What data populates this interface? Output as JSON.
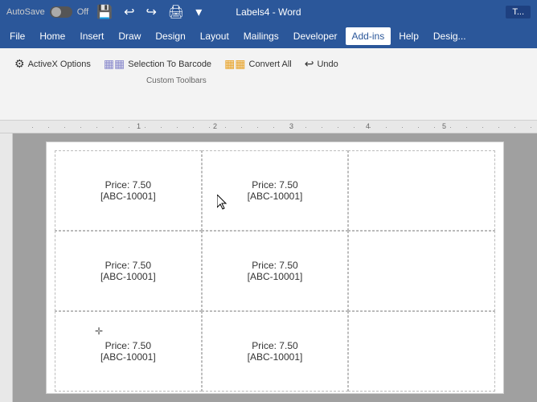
{
  "titlebar": {
    "autosave_label": "AutoSave",
    "autosave_state": "Off",
    "title": "Labels4 - Word",
    "tab_label": "T..."
  },
  "menubar": {
    "items": [
      {
        "label": "File",
        "id": "file"
      },
      {
        "label": "Home",
        "id": "home"
      },
      {
        "label": "Insert",
        "id": "insert"
      },
      {
        "label": "Draw",
        "id": "draw"
      },
      {
        "label": "Design",
        "id": "design"
      },
      {
        "label": "Layout",
        "id": "layout"
      },
      {
        "label": "Mailings",
        "id": "mailings"
      },
      {
        "label": "Developer",
        "id": "developer"
      },
      {
        "label": "Add-ins",
        "id": "addins",
        "active": true
      },
      {
        "label": "Help",
        "id": "help"
      },
      {
        "label": "Desig...",
        "id": "desig2"
      }
    ]
  },
  "ribbon": {
    "buttons": [
      {
        "id": "activex",
        "icon": "⚙",
        "label": "ActiveX Options"
      },
      {
        "id": "selection-barcode",
        "icon": "▦",
        "label": "Selection To Barcode"
      },
      {
        "id": "convert-all",
        "icon": "▦",
        "label": "Convert All"
      },
      {
        "id": "undo",
        "icon": "↩",
        "label": "Undo"
      }
    ],
    "group_label": "Custom Toolbars"
  },
  "labels": {
    "rows": [
      [
        {
          "price": "Price: 7.50",
          "code": "[ABC-10001]"
        },
        {
          "price": "Price: 7.50",
          "code": "[ABC-10001]"
        },
        {
          "price": "",
          "code": ""
        }
      ],
      [
        {
          "price": "Price: 7.50",
          "code": "[ABC-10001]"
        },
        {
          "price": "Price: 7.50",
          "code": "[ABC-10001]"
        },
        {
          "price": "",
          "code": ""
        }
      ],
      [
        {
          "price": "Price: 7.50",
          "code": "[ABC-10001]"
        },
        {
          "price": "Price: 7.50",
          "code": "[ABC-10001]"
        },
        {
          "price": "",
          "code": ""
        }
      ]
    ]
  }
}
